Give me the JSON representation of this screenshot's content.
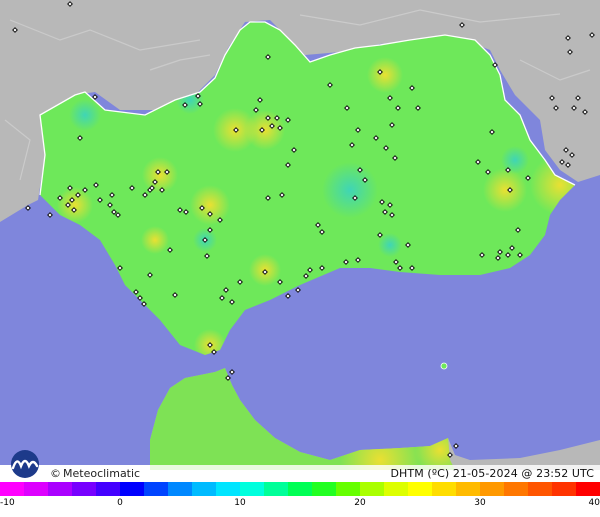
{
  "brand": {
    "copyright_symbol": "©",
    "name": "Meteoclimatic",
    "logo_icon": "wave-logo-icon"
  },
  "caption": {
    "text": "DHTM (ºC)  21-05-2024 @ 23:52 UTC"
  },
  "colors": {
    "sea": "#7f86dc",
    "land_outside": "#b9b9b9",
    "region_base": "#6ee85a",
    "region_border": "#ffffff",
    "station_marker": "#000000"
  },
  "scale": {
    "min": -10,
    "max": 40,
    "ticks": [
      {
        "label": "-10",
        "value": -10
      },
      {
        "label": "0",
        "value": 0
      },
      {
        "label": "10",
        "value": 10
      },
      {
        "label": "20",
        "value": 20
      },
      {
        "label": "30",
        "value": 30
      },
      {
        "label": "40",
        "value": 40
      }
    ],
    "colors": [
      "#ff00ff",
      "#dd00ff",
      "#aa00ff",
      "#7700ff",
      "#4400ff",
      "#0000ff",
      "#0044ff",
      "#0088ff",
      "#00bbff",
      "#00e5ff",
      "#00ffdd",
      "#00ff99",
      "#00ff55",
      "#22ff22",
      "#66ff00",
      "#aaff00",
      "#ddff00",
      "#ffff00",
      "#ffdd00",
      "#ffbb00",
      "#ff9900",
      "#ff7700",
      "#ff5500",
      "#ff3300",
      "#ff0000"
    ]
  }
}
